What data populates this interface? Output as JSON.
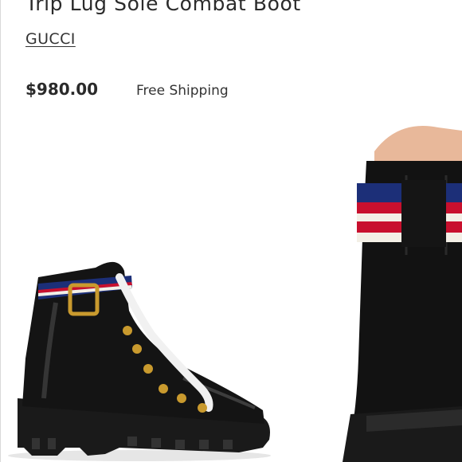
{
  "product": {
    "title": "Trip Lug Sole Combat Boot",
    "brand": "GUCCI",
    "price": "$980.00",
    "shipping": "Free Shipping"
  },
  "images": [
    {
      "name": "boot-side-view-image"
    },
    {
      "name": "boot-back-closeup-image"
    }
  ]
}
